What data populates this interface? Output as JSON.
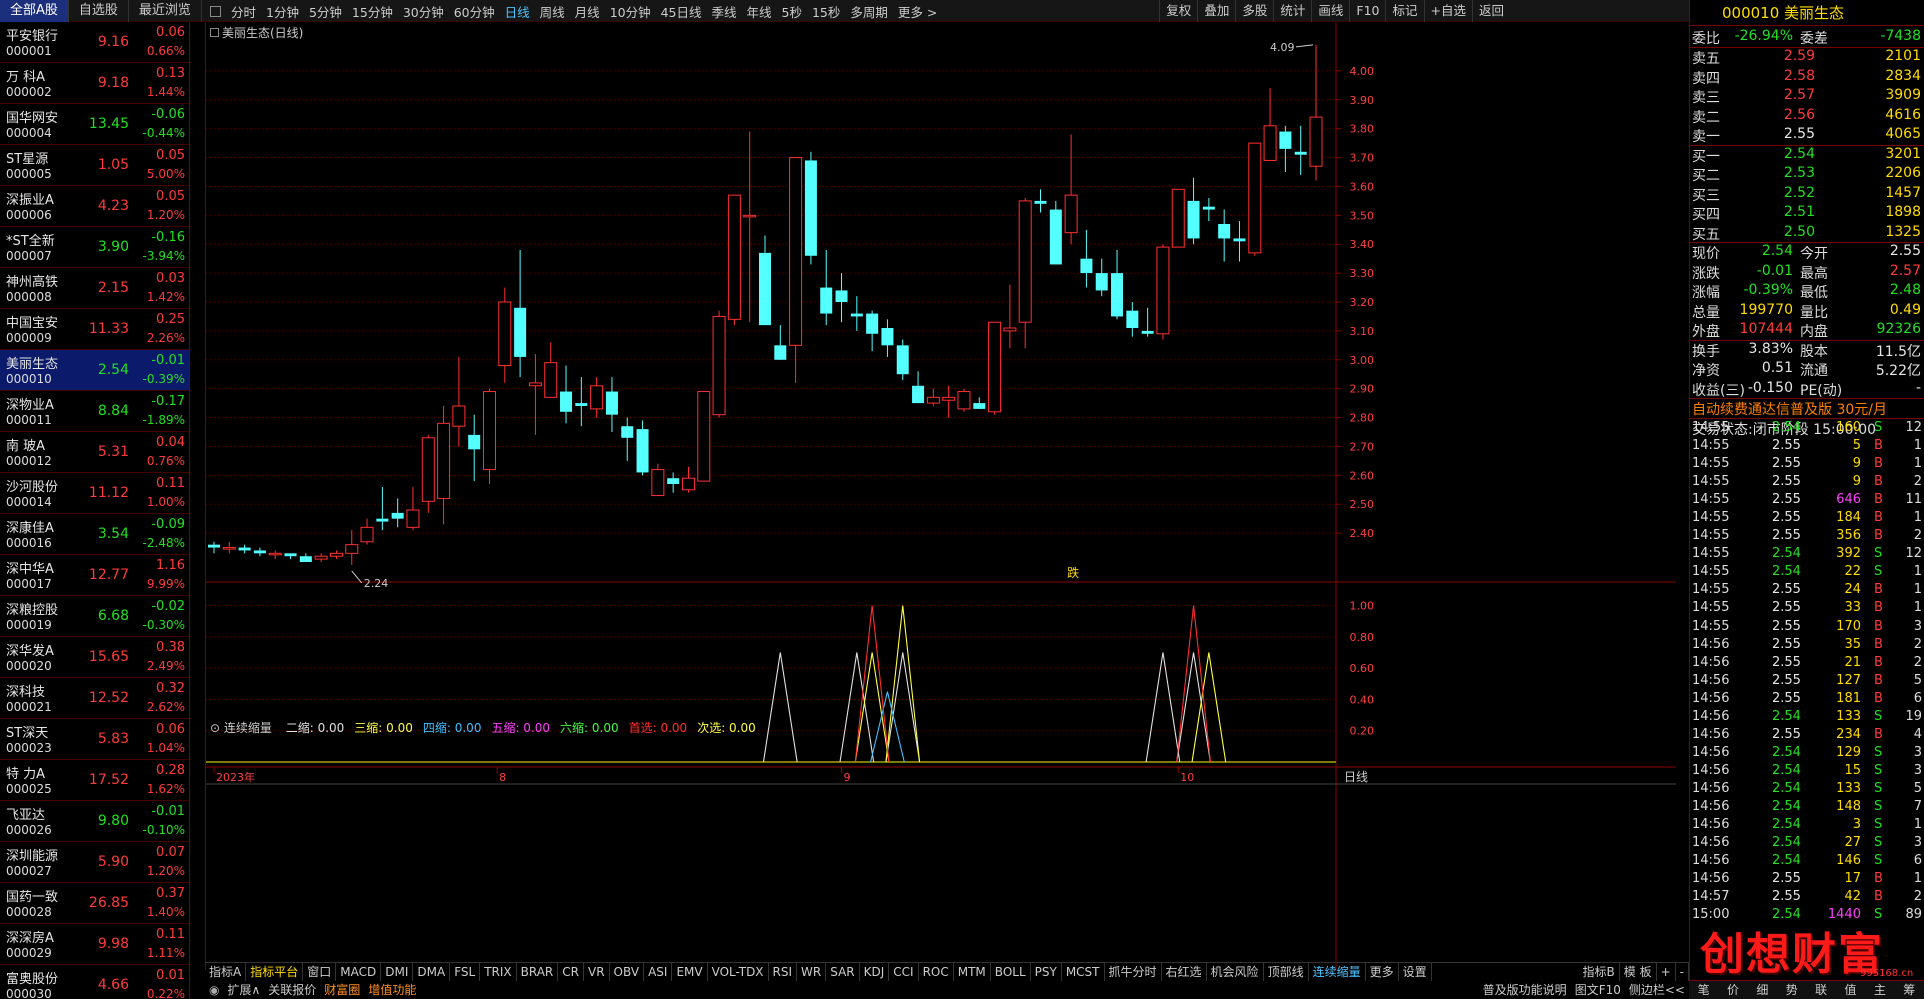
{
  "topbar": {
    "tabs": [
      "全部A股",
      "自选股",
      "最近浏览"
    ],
    "periods": [
      "分时",
      "1分钟",
      "5分钟",
      "15分钟",
      "30分钟",
      "60分钟",
      "日线",
      "周线",
      "月线",
      "10分钟",
      "45日线",
      "季线",
      "年线",
      "5秒",
      "15秒",
      "多周期",
      "更多 >"
    ],
    "active_period": "日线",
    "tools": [
      "复权",
      "叠加",
      "多股",
      "统计",
      "画线",
      "F10",
      "标记",
      "+自选",
      "返回"
    ]
  },
  "stocks": [
    {
      "name": "平安银行",
      "code": "000001",
      "price": "9.16",
      "chg": "0.06",
      "pct": "0.66%",
      "dir": "up"
    },
    {
      "name": "万 科A",
      "code": "000002",
      "price": "9.18",
      "chg": "0.13",
      "pct": "1.44%",
      "dir": "up"
    },
    {
      "name": "国华网安",
      "code": "000004",
      "price": "13.45",
      "chg": "-0.06",
      "pct": "-0.44%",
      "dir": "dn"
    },
    {
      "name": "ST星源",
      "code": "000005",
      "price": "1.05",
      "chg": "0.05",
      "pct": "5.00%",
      "dir": "up"
    },
    {
      "name": "深振业A",
      "code": "000006",
      "price": "4.23",
      "chg": "0.05",
      "pct": "1.20%",
      "dir": "up"
    },
    {
      "name": "*ST全新",
      "code": "000007",
      "price": "3.90",
      "chg": "-0.16",
      "pct": "-3.94%",
      "dir": "dn"
    },
    {
      "name": "神州高铁",
      "code": "000008",
      "price": "2.15",
      "chg": "0.03",
      "pct": "1.42%",
      "dir": "up"
    },
    {
      "name": "中国宝安",
      "code": "000009",
      "price": "11.33",
      "chg": "0.25",
      "pct": "2.26%",
      "dir": "up"
    },
    {
      "name": "美丽生态",
      "code": "000010",
      "price": "2.54",
      "chg": "-0.01",
      "pct": "-0.39%",
      "dir": "dn",
      "sel": true
    },
    {
      "name": "深物业A",
      "code": "000011",
      "price": "8.84",
      "chg": "-0.17",
      "pct": "-1.89%",
      "dir": "dn"
    },
    {
      "name": "南 玻A",
      "code": "000012",
      "price": "5.31",
      "chg": "0.04",
      "pct": "0.76%",
      "dir": "up"
    },
    {
      "name": "沙河股份",
      "code": "000014",
      "price": "11.12",
      "chg": "0.11",
      "pct": "1.00%",
      "dir": "up"
    },
    {
      "name": "深康佳A",
      "code": "000016",
      "price": "3.54",
      "chg": "-0.09",
      "pct": "-2.48%",
      "dir": "dn"
    },
    {
      "name": "深中华A",
      "code": "000017",
      "price": "12.77",
      "chg": "1.16",
      "pct": "9.99%",
      "dir": "up"
    },
    {
      "name": "深粮控股",
      "code": "000019",
      "price": "6.68",
      "chg": "-0.02",
      "pct": "-0.30%",
      "dir": "dn"
    },
    {
      "name": "深华发A",
      "code": "000020",
      "price": "15.65",
      "chg": "0.38",
      "pct": "2.49%",
      "dir": "up"
    },
    {
      "name": "深科技",
      "code": "000021",
      "price": "12.52",
      "chg": "0.32",
      "pct": "2.62%",
      "dir": "up"
    },
    {
      "name": "ST深天",
      "code": "000023",
      "price": "5.83",
      "chg": "0.06",
      "pct": "1.04%",
      "dir": "up"
    },
    {
      "name": "特 力A",
      "code": "000025",
      "price": "17.52",
      "chg": "0.28",
      "pct": "1.62%",
      "dir": "up"
    },
    {
      "name": "飞亚达",
      "code": "000026",
      "price": "9.80",
      "chg": "-0.01",
      "pct": "-0.10%",
      "dir": "dn"
    },
    {
      "name": "深圳能源",
      "code": "000027",
      "price": "5.90",
      "chg": "0.07",
      "pct": "1.20%",
      "dir": "up"
    },
    {
      "name": "国药一致",
      "code": "000028",
      "price": "26.85",
      "chg": "0.37",
      "pct": "1.40%",
      "dir": "up"
    },
    {
      "name": "深深房A",
      "code": "000029",
      "price": "9.98",
      "chg": "0.11",
      "pct": "1.11%",
      "dir": "up"
    },
    {
      "name": "富奥股份",
      "code": "000030",
      "price": "4.66",
      "chg": "0.01",
      "pct": "0.22%",
      "dir": "up"
    }
  ],
  "chart": {
    "title": "美丽生态(日线)",
    "high_label": "4.09",
    "low_label": "2.24",
    "marker": "跌",
    "indicator_title": "连续缩量",
    "indicator_legend": [
      {
        "label": "二缩: 0.00",
        "color": "#e0e0e0"
      },
      {
        "label": "三缩: 0.00",
        "color": "#ffff40"
      },
      {
        "label": "四缩: 0.00",
        "color": "#40c0ff"
      },
      {
        "label": "五缩: 0.00",
        "color": "#ff40ff"
      },
      {
        "label": "六缩: 0.00",
        "color": "#40ff40"
      },
      {
        "label": "首选: 0.00",
        "color": "#ff3030"
      },
      {
        "label": "次选: 0.00",
        "color": "#ffff40"
      }
    ],
    "date_labels": [
      "2023年",
      "8",
      "9",
      "10"
    ],
    "axis_corner": "日线"
  },
  "chart_data": {
    "type": "candlestick",
    "ylim": [
      2.3,
      4.1
    ],
    "price_ticks": [
      "4.00",
      "3.90",
      "3.80",
      "3.70",
      "3.60",
      "3.50",
      "3.40",
      "3.30",
      "3.20",
      "3.10",
      "3.00",
      "2.90",
      "2.80",
      "2.70",
      "2.60",
      "2.50",
      "2.40"
    ],
    "indicator_ticks": [
      "1.00",
      "0.80",
      "0.60",
      "0.40",
      "0.20"
    ],
    "candles": [
      [
        2.36,
        2.35,
        2.37,
        2.33
      ],
      [
        2.35,
        2.35,
        2.37,
        2.33
      ],
      [
        2.35,
        2.34,
        2.36,
        2.33
      ],
      [
        2.34,
        2.33,
        2.35,
        2.32
      ],
      [
        2.33,
        2.33,
        2.34,
        2.31
      ],
      [
        2.33,
        2.32,
        2.33,
        2.31
      ],
      [
        2.32,
        2.3,
        2.33,
        2.3
      ],
      [
        2.31,
        2.32,
        2.33,
        2.3
      ],
      [
        2.32,
        2.33,
        2.34,
        2.31
      ],
      [
        2.33,
        2.36,
        2.41,
        2.29
      ],
      [
        2.37,
        2.42,
        2.45,
        2.36
      ],
      [
        2.45,
        2.44,
        2.56,
        2.41
      ],
      [
        2.47,
        2.45,
        2.52,
        2.42
      ],
      [
        2.42,
        2.48,
        2.56,
        2.41
      ],
      [
        2.51,
        2.73,
        2.74,
        2.47
      ],
      [
        2.52,
        2.78,
        2.84,
        2.43
      ],
      [
        2.77,
        2.84,
        3.01,
        2.7
      ],
      [
        2.74,
        2.69,
        2.81,
        2.58
      ],
      [
        2.62,
        2.89,
        2.9,
        2.57
      ],
      [
        2.98,
        3.2,
        3.25,
        2.92
      ],
      [
        3.18,
        3.01,
        3.38,
        2.94
      ],
      [
        2.91,
        2.92,
        3.02,
        2.74
      ],
      [
        2.87,
        2.99,
        3.06,
        2.88
      ],
      [
        2.89,
        2.82,
        2.98,
        2.78
      ],
      [
        2.85,
        2.84,
        2.94,
        2.77
      ],
      [
        2.83,
        2.91,
        2.94,
        2.8
      ],
      [
        2.89,
        2.81,
        2.94,
        2.75
      ],
      [
        2.77,
        2.73,
        2.8,
        2.65
      ],
      [
        2.76,
        2.61,
        2.79,
        2.6
      ],
      [
        2.53,
        2.62,
        2.64,
        2.53
      ],
      [
        2.59,
        2.57,
        2.61,
        2.54
      ],
      [
        2.55,
        2.59,
        2.63,
        2.54
      ],
      [
        2.58,
        2.89,
        2.89,
        2.58
      ],
      [
        2.81,
        3.15,
        3.17,
        2.8
      ],
      [
        3.14,
        3.57,
        3.57,
        3.12
      ],
      [
        3.5,
        3.5,
        3.79,
        3.13
      ],
      [
        3.37,
        3.12,
        3.43,
        3.12
      ],
      [
        3.05,
        3.0,
        3.12,
        3.0
      ],
      [
        3.05,
        3.7,
        3.7,
        2.92
      ],
      [
        3.69,
        3.36,
        3.72,
        3.33
      ],
      [
        3.25,
        3.16,
        3.38,
        3.12
      ],
      [
        3.24,
        3.2,
        3.3,
        3.13
      ],
      [
        3.16,
        3.15,
        3.22,
        3.1
      ],
      [
        3.16,
        3.09,
        3.17,
        3.03
      ],
      [
        3.11,
        3.05,
        3.14,
        3.01
      ],
      [
        3.05,
        2.95,
        3.07,
        2.93
      ],
      [
        2.91,
        2.85,
        2.96,
        2.85
      ],
      [
        2.85,
        2.87,
        2.9,
        2.84
      ],
      [
        2.86,
        2.87,
        2.91,
        2.8
      ],
      [
        2.83,
        2.89,
        2.9,
        2.82
      ],
      [
        2.85,
        2.83,
        2.87,
        2.83
      ],
      [
        2.82,
        3.13,
        3.13,
        2.81
      ],
      [
        3.1,
        3.11,
        3.26,
        3.04
      ],
      [
        3.13,
        3.55,
        3.56,
        3.04
      ],
      [
        3.55,
        3.54,
        3.59,
        3.51
      ],
      [
        3.52,
        3.33,
        3.55,
        3.33
      ],
      [
        3.44,
        3.57,
        3.78,
        3.4
      ],
      [
        3.35,
        3.3,
        3.45,
        3.25
      ],
      [
        3.3,
        3.24,
        3.35,
        3.22
      ],
      [
        3.3,
        3.15,
        3.38,
        3.14
      ],
      [
        3.17,
        3.11,
        3.2,
        3.08
      ],
      [
        3.1,
        3.09,
        3.18,
        3.08
      ],
      [
        3.09,
        3.39,
        3.4,
        3.07
      ],
      [
        3.39,
        3.59,
        3.59,
        3.39
      ],
      [
        3.55,
        3.42,
        3.63,
        3.4
      ],
      [
        3.53,
        3.52,
        3.56,
        3.48
      ],
      [
        3.47,
        3.42,
        3.52,
        3.34
      ],
      [
        3.42,
        3.41,
        3.48,
        3.34
      ],
      [
        3.37,
        3.75,
        3.75,
        3.36
      ],
      [
        3.69,
        3.81,
        3.94,
        3.81
      ],
      [
        3.79,
        3.73,
        3.81,
        3.65
      ],
      [
        3.72,
        3.71,
        3.81,
        3.64
      ],
      [
        3.67,
        3.84,
        4.09,
        3.62
      ]
    ],
    "indicator_series": [
      {
        "color": "#e0e0e0",
        "peaks": [
          [
            37,
            0.7
          ],
          [
            42,
            0.7
          ],
          [
            45,
            0.7
          ],
          [
            62,
            0.7
          ],
          [
            64,
            0.7
          ]
        ]
      },
      {
        "color": "#ffff40",
        "peaks": [
          [
            43,
            0.7
          ],
          [
            45,
            1.0
          ],
          [
            65,
            0.7
          ]
        ]
      },
      {
        "color": "#40c0ff",
        "peaks": [
          [
            44,
            0.45
          ]
        ]
      },
      {
        "color": "#ff3030",
        "peaks": [
          [
            43,
            1.0
          ],
          [
            64,
            1.0
          ]
        ]
      }
    ]
  },
  "right": {
    "code": "000010",
    "name": "美丽生态",
    "weibi_label": "委比",
    "weibi": "-26.94%",
    "weicha_label": "委差",
    "weicha": "-7438",
    "asks": [
      {
        "label": "卖五",
        "price": "2.59",
        "vol": "2101",
        "dir": "up"
      },
      {
        "label": "卖四",
        "price": "2.58",
        "vol": "2834",
        "dir": "up"
      },
      {
        "label": "卖三",
        "price": "2.57",
        "vol": "3909",
        "dir": "up"
      },
      {
        "label": "卖二",
        "price": "2.56",
        "vol": "4616",
        "dir": "up"
      },
      {
        "label": "卖一",
        "price": "2.55",
        "vol": "4065",
        "dir": "eq"
      }
    ],
    "bids": [
      {
        "label": "买一",
        "price": "2.54",
        "vol": "3201",
        "dir": "dn"
      },
      {
        "label": "买二",
        "price": "2.53",
        "vol": "2206",
        "dir": "dn"
      },
      {
        "label": "买三",
        "price": "2.52",
        "vol": "1457",
        "dir": "dn"
      },
      {
        "label": "买四",
        "price": "2.51",
        "vol": "1898",
        "dir": "dn"
      },
      {
        "label": "买五",
        "price": "2.50",
        "vol": "1325",
        "dir": "dn"
      }
    ],
    "quotes": [
      [
        "现价",
        "2.54",
        "dn",
        "今开",
        "2.55",
        "wh"
      ],
      [
        "涨跌",
        "-0.01",
        "dn",
        "最高",
        "2.57",
        "up"
      ],
      [
        "涨幅",
        "-0.39%",
        "dn",
        "最低",
        "2.48",
        "dn"
      ],
      [
        "总量",
        "199770",
        "yl",
        "量比",
        "0.49",
        "yl"
      ],
      [
        "外盘",
        "107444",
        "up",
        "内盘",
        "92326",
        "dn"
      ],
      [
        "换手",
        "3.83%",
        "wh",
        "股本",
        "11.5亿",
        "wh"
      ],
      [
        "净资",
        "0.51",
        "wh",
        "流通",
        "5.22亿",
        "wh"
      ],
      [
        "收益(三)",
        "-0.150",
        "wh",
        "PE(动)",
        "-",
        "wh"
      ]
    ],
    "notice": "自动续费通达信普及版  30元/月",
    "status_label": "交易状态:",
    "status": "闭市阶段",
    "status_time": "15:00:00",
    "ticks": [
      [
        "14:55",
        "2.54",
        "160",
        "S",
        "12"
      ],
      [
        "14:55",
        "2.55",
        "5",
        "B",
        "1"
      ],
      [
        "14:55",
        "2.55",
        "9",
        "B",
        "1"
      ],
      [
        "14:55",
        "2.55",
        "9",
        "B",
        "2"
      ],
      [
        "14:55",
        "2.55",
        "646",
        "B",
        "11"
      ],
      [
        "14:55",
        "2.55",
        "184",
        "B",
        "1"
      ],
      [
        "14:55",
        "2.55",
        "356",
        "B",
        "2"
      ],
      [
        "14:55",
        "2.54",
        "392",
        "S",
        "12"
      ],
      [
        "14:55",
        "2.54",
        "22",
        "S",
        "1"
      ],
      [
        "14:55",
        "2.55",
        "24",
        "B",
        "1"
      ],
      [
        "14:55",
        "2.55",
        "33",
        "B",
        "1"
      ],
      [
        "14:55",
        "2.55",
        "170",
        "B",
        "3"
      ],
      [
        "14:56",
        "2.55",
        "35",
        "B",
        "2"
      ],
      [
        "14:56",
        "2.55",
        "21",
        "B",
        "2"
      ],
      [
        "14:56",
        "2.55",
        "127",
        "B",
        "5"
      ],
      [
        "14:56",
        "2.55",
        "181",
        "B",
        "6"
      ],
      [
        "14:56",
        "2.54",
        "133",
        "S",
        "19"
      ],
      [
        "14:56",
        "2.55",
        "234",
        "B",
        "4"
      ],
      [
        "14:56",
        "2.54",
        "129",
        "S",
        "3"
      ],
      [
        "14:56",
        "2.54",
        "15",
        "S",
        "3"
      ],
      [
        "14:56",
        "2.54",
        "133",
        "S",
        "5"
      ],
      [
        "14:56",
        "2.54",
        "148",
        "S",
        "7"
      ],
      [
        "14:56",
        "2.54",
        "3",
        "S",
        "1"
      ],
      [
        "14:56",
        "2.54",
        "27",
        "S",
        "3"
      ],
      [
        "14:56",
        "2.54",
        "146",
        "S",
        "6"
      ],
      [
        "14:56",
        "2.55",
        "17",
        "B",
        "1"
      ],
      [
        "14:57",
        "2.55",
        "42",
        "B",
        "2"
      ],
      [
        "15:00",
        "2.54",
        "1440",
        "S",
        "89"
      ]
    ]
  },
  "bottombar": {
    "items": [
      "指标A",
      "指标平台",
      "窗口",
      "MACD",
      "DMI",
      "DMA",
      "FSL",
      "TRIX",
      "BRAR",
      "CR",
      "VR",
      "OBV",
      "ASI",
      "EMV",
      "VOL-TDX",
      "RSI",
      "WR",
      "SAR",
      "KDJ",
      "CCI",
      "ROC",
      "MTM",
      "BOLL",
      "PSY",
      "MCST",
      "抓牛分时",
      "右红选",
      "机会风险",
      "顶部线",
      "连续缩量",
      "更多",
      "设置"
    ],
    "right_items": [
      "指标B",
      "模 板",
      "+",
      "-"
    ],
    "row2": [
      "扩展∧",
      "关联报价",
      "财富圈",
      "增值功能"
    ],
    "row2_right": [
      "普及版功能说明",
      "图文F10",
      "侧边栏<<"
    ]
  },
  "right_tabs": [
    "笔",
    "价",
    "细",
    "势",
    "联",
    "值",
    "主",
    "筹"
  ],
  "watermark": {
    "text": "创想财富",
    "sub": "995168.cn"
  }
}
